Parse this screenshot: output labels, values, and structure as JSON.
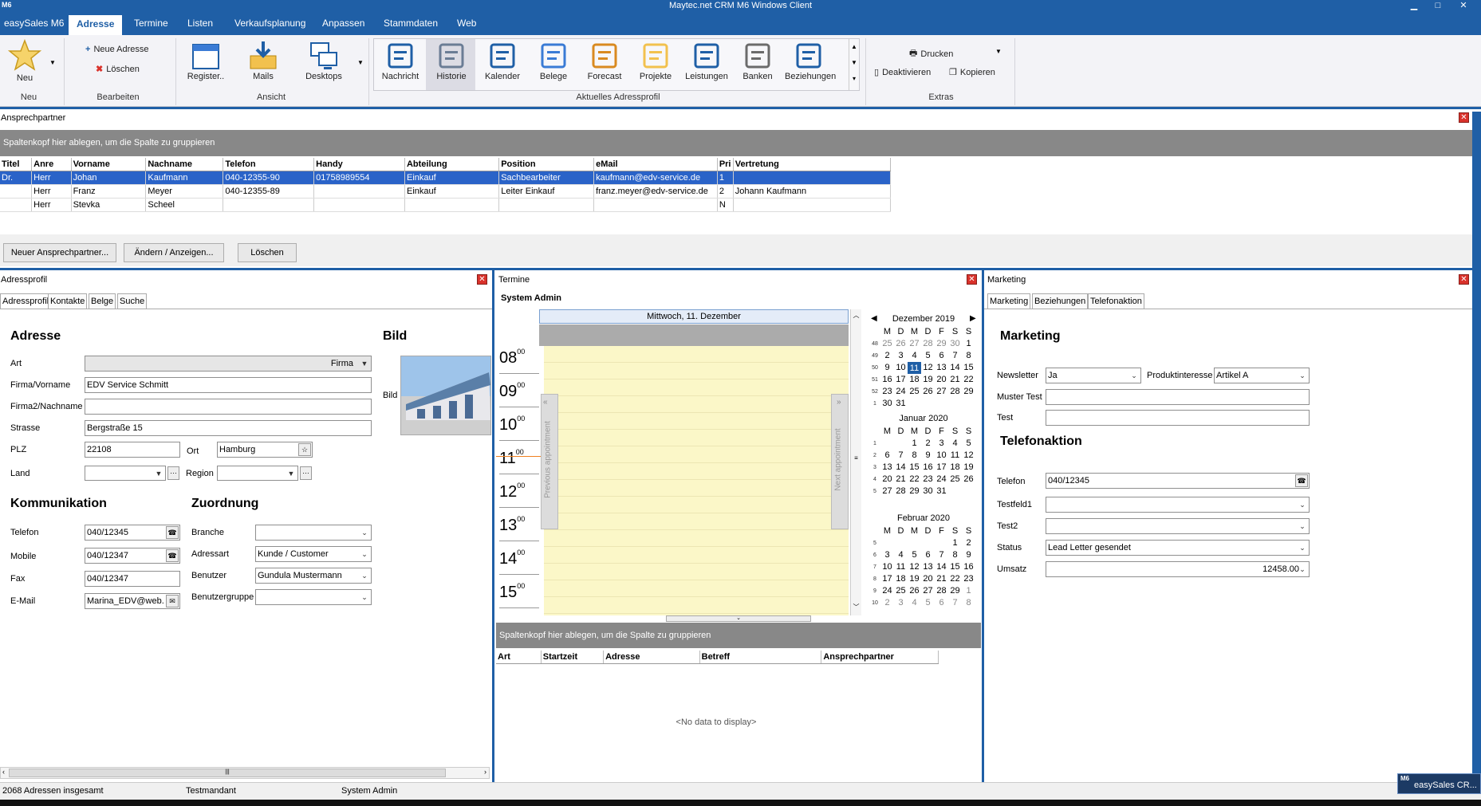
{
  "window": {
    "title": "Maytec.net CRM M6 Windows Client",
    "badge": "M6",
    "min": "▁",
    "max": "□",
    "close": "✕"
  },
  "menu": [
    "easySales M6",
    "Adresse",
    "Termine",
    "Listen",
    "Verkaufsplanung",
    "Anpassen",
    "Stammdaten",
    "Web"
  ],
  "ribbon": {
    "neu": {
      "label": "Neu",
      "group": "Neu"
    },
    "bearbeiten": {
      "new_address": "Neue Adresse",
      "delete": "Löschen",
      "group": "Bearbeiten"
    },
    "ansicht": {
      "register": "Register..",
      "mails": "Mails",
      "desktops": "Desktops",
      "group": "Ansicht"
    },
    "profil": {
      "items": [
        "Nachricht",
        "Historie",
        "Kalender",
        "Belege",
        "Forecast",
        "Projekte",
        "Leistungen",
        "Banken",
        "Beziehungen"
      ],
      "group": "Aktuelles Adressprofil"
    },
    "extras": {
      "print": "Drucken",
      "deactivate": "Deaktivieren",
      "copy": "Kopieren",
      "group": "Extras"
    }
  },
  "ansprechpartner": {
    "title": "Ansprechpartner",
    "group_hint": "Spaltenkopf hier ablegen, um die Spalte zu gruppieren",
    "columns": [
      "Titel",
      "Anre",
      "Vorname",
      "Nachname",
      "Telefon",
      "Handy",
      "Abteilung",
      "Position",
      "eMail",
      "Pri",
      "Vertretung"
    ],
    "rows": [
      [
        "Dr.",
        "Herr",
        "Johan",
        "Kaufmann",
        "040-12355-90",
        "01758989554",
        "Einkauf",
        "Sachbearbeiter",
        "kaufmann@edv-service.de",
        "1",
        ""
      ],
      [
        "",
        "Herr",
        "Franz",
        "Meyer",
        "040-12355-89",
        "",
        "Einkauf",
        "Leiter Einkauf",
        "franz.meyer@edv-service.de",
        "2",
        "Johann Kaufmann"
      ],
      [
        "",
        "Herr",
        "Stevka",
        "Scheel",
        "",
        "",
        "",
        "",
        "",
        "N",
        ""
      ]
    ],
    "buttons": [
      "Neuer Ansprechpartner...",
      "Ändern / Anzeigen...",
      "Löschen"
    ]
  },
  "adressprofil": {
    "title": "Adressprofil",
    "tabs": [
      "Adressprofil",
      "Kontakte",
      "Belge",
      "Suche"
    ],
    "adresse_title": "Adresse",
    "bild_title": "Bild",
    "bild_label": "Bild",
    "fields": {
      "art_label": "Art",
      "art": "Firma",
      "firma_label": "Firma/Vorname",
      "firma": "EDV Service Schmitt",
      "firma2_label": "Firma2/Nachname",
      "firma2": "",
      "strasse_label": "Strasse",
      "strasse": "Bergstraße 15",
      "plz_label": "PLZ",
      "plz": "22108",
      "ort_label": "Ort",
      "ort": "Hamburg",
      "land_label": "Land",
      "region_label": "Region"
    },
    "komm_title": "Kommunikation",
    "komm": {
      "telefon_label": "Telefon",
      "telefon": "040/12345",
      "mobile_label": "Mobile",
      "mobile": "040/12347",
      "fax_label": "Fax",
      "fax": "040/12347",
      "email_label": "E-Mail",
      "email": "Marina_EDV@web."
    },
    "zuord_title": "Zuordnung",
    "zuord": {
      "branche_label": "Branche",
      "branche": "",
      "adressart_label": "Adressart",
      "adressart": "Kunde / Customer",
      "benutzer_label": "Benutzer",
      "benutzer": "Gundula Mustermann",
      "gruppe_label": "Benutzergruppe",
      "gruppe": ""
    }
  },
  "termine": {
    "title": "Termine",
    "user": "System Admin",
    "date": "Mittwoch, 11. Dezember",
    "hours": [
      "08",
      "09",
      "10",
      "11",
      "12",
      "13",
      "14",
      "15"
    ],
    "minutes": "00",
    "prev": "Previous appointment",
    "next": "Next appointment",
    "group_hint": "Spaltenkopf hier ablegen, um die Spalte zu gruppieren",
    "columns": [
      "Art",
      "Startzeit",
      "Adresse",
      "Betreff",
      "Ansprechpartner"
    ],
    "empty": "<No data to display>",
    "calendar": [
      {
        "title": "Dezember 2019",
        "rows": [
          [
            "48",
            "25",
            "26",
            "27",
            "28",
            "29",
            "30",
            "1"
          ],
          [
            "49",
            "2",
            "3",
            "4",
            "5",
            "6",
            "7",
            "8"
          ],
          [
            "50",
            "9",
            "10",
            "11",
            "12",
            "13",
            "14",
            "15"
          ],
          [
            "51",
            "16",
            "17",
            "18",
            "19",
            "20",
            "21",
            "22"
          ],
          [
            "52",
            "23",
            "24",
            "25",
            "26",
            "27",
            "28",
            "29"
          ],
          [
            "1",
            "30",
            "31",
            "",
            "",
            "",
            "",
            ""
          ]
        ]
      },
      {
        "title": "Januar 2020",
        "rows": [
          [
            "1",
            "",
            "",
            "1",
            "2",
            "3",
            "4",
            "5"
          ],
          [
            "2",
            "6",
            "7",
            "8",
            "9",
            "10",
            "11",
            "12"
          ],
          [
            "3",
            "13",
            "14",
            "15",
            "16",
            "17",
            "18",
            "19"
          ],
          [
            "4",
            "20",
            "21",
            "22",
            "23",
            "24",
            "25",
            "26"
          ],
          [
            "5",
            "27",
            "28",
            "29",
            "30",
            "31",
            "",
            ""
          ]
        ]
      },
      {
        "title": "Februar 2020",
        "rows": [
          [
            "5",
            "",
            "",
            "",
            "",
            "",
            "1",
            "2"
          ],
          [
            "6",
            "3",
            "4",
            "5",
            "6",
            "7",
            "8",
            "9"
          ],
          [
            "7",
            "10",
            "11",
            "12",
            "13",
            "14",
            "15",
            "16"
          ],
          [
            "8",
            "17",
            "18",
            "19",
            "20",
            "21",
            "22",
            "23"
          ],
          [
            "9",
            "24",
            "25",
            "26",
            "27",
            "28",
            "29",
            "1"
          ],
          [
            "10",
            "2",
            "3",
            "4",
            "5",
            "6",
            "7",
            "8"
          ]
        ]
      }
    ],
    "weekdays": [
      "M",
      "D",
      "M",
      "D",
      "F",
      "S",
      "S"
    ]
  },
  "marketing": {
    "title": "Marketing",
    "tabs": [
      "Marketing",
      "Beziehungen",
      "Telefonaktion"
    ],
    "m_title": "Marketing",
    "newsletter_label": "Newsletter",
    "newsletter": "Ja",
    "produkt_label": "Produktinteresse",
    "produkt": "Artikel A",
    "muster_label": "Muster Test",
    "test_label": "Test",
    "t_title": "Telefonaktion",
    "telefon_label": "Telefon",
    "telefon": "040/12345",
    "testfeld_label": "Testfeld1",
    "test2_label": "Test2",
    "status_label": "Status",
    "status": "Lead Letter gesendet",
    "umsatz_label": "Umsatz",
    "umsatz": "12458.00"
  },
  "status": {
    "count": "2068 Adressen insgesamt",
    "mandant": "Testmandant",
    "user": "System Admin"
  },
  "taskbar": {
    "badge": "M6",
    "label": "easySales CR..."
  }
}
